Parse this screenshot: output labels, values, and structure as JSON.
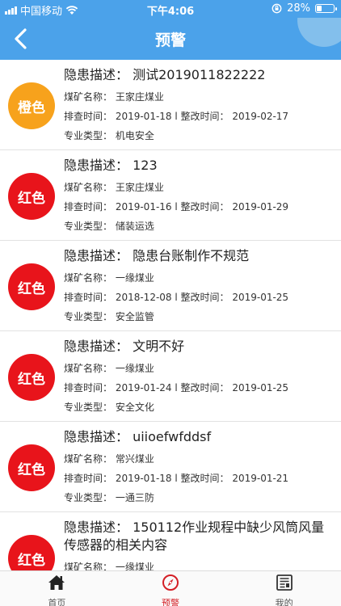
{
  "status_bar": {
    "carrier": "中国移动",
    "time": "下午4:06",
    "battery": "28%"
  },
  "nav": {
    "title": "预警"
  },
  "colors": {
    "primary": "#4ba2ea",
    "orange": "#f7a21c",
    "red": "#e8141b",
    "active_tab": "#d41f26"
  },
  "warnings": [
    {
      "level": "橙色",
      "level_color": "#f7a21c",
      "desc": "隐患描述：  测试2019011822222",
      "mine": "煤矿名称：  王家庄煤业",
      "times": "排查时间：  2019-01-18 l 整改时间：  2019-02-17",
      "type": "专业类型：  机电安全"
    },
    {
      "level": "红色",
      "level_color": "#e8141b",
      "desc": "隐患描述：  123",
      "mine": "煤矿名称：  王家庄煤业",
      "times": "排查时间：  2019-01-16 l 整改时间：  2019-01-29",
      "type": "专业类型：  储装运选"
    },
    {
      "level": "红色",
      "level_color": "#e8141b",
      "desc": "隐患描述：  隐患台账制作不规范",
      "mine": "煤矿名称：  一缘煤业",
      "times": "排查时间：  2018-12-08 l 整改时间：  2019-01-25",
      "type": "专业类型：  安全监管"
    },
    {
      "level": "红色",
      "level_color": "#e8141b",
      "desc": "隐患描述：  文明不好",
      "mine": "煤矿名称：  一缘煤业",
      "times": "排查时间：  2019-01-24 l 整改时间：  2019-01-25",
      "type": "专业类型：  安全文化"
    },
    {
      "level": "红色",
      "level_color": "#e8141b",
      "desc": "隐患描述：  uiioefwfddsf",
      "mine": "煤矿名称：  常兴煤业",
      "times": "排查时间：  2019-01-18 l 整改时间：  2019-01-21",
      "type": "专业类型：  一通三防"
    },
    {
      "level": "红色",
      "level_color": "#e8141b",
      "desc": "隐患描述：  150112作业规程中缺少风筒风量传感器的相关内容",
      "mine": "煤矿名称：  一缘煤业",
      "times": "",
      "type": ""
    }
  ],
  "tabs": [
    {
      "label": "首页",
      "icon": "home-icon",
      "active": false
    },
    {
      "label": "预警",
      "icon": "warning-compass-icon",
      "active": true
    },
    {
      "label": "我的",
      "icon": "profile-list-icon",
      "active": false
    }
  ]
}
